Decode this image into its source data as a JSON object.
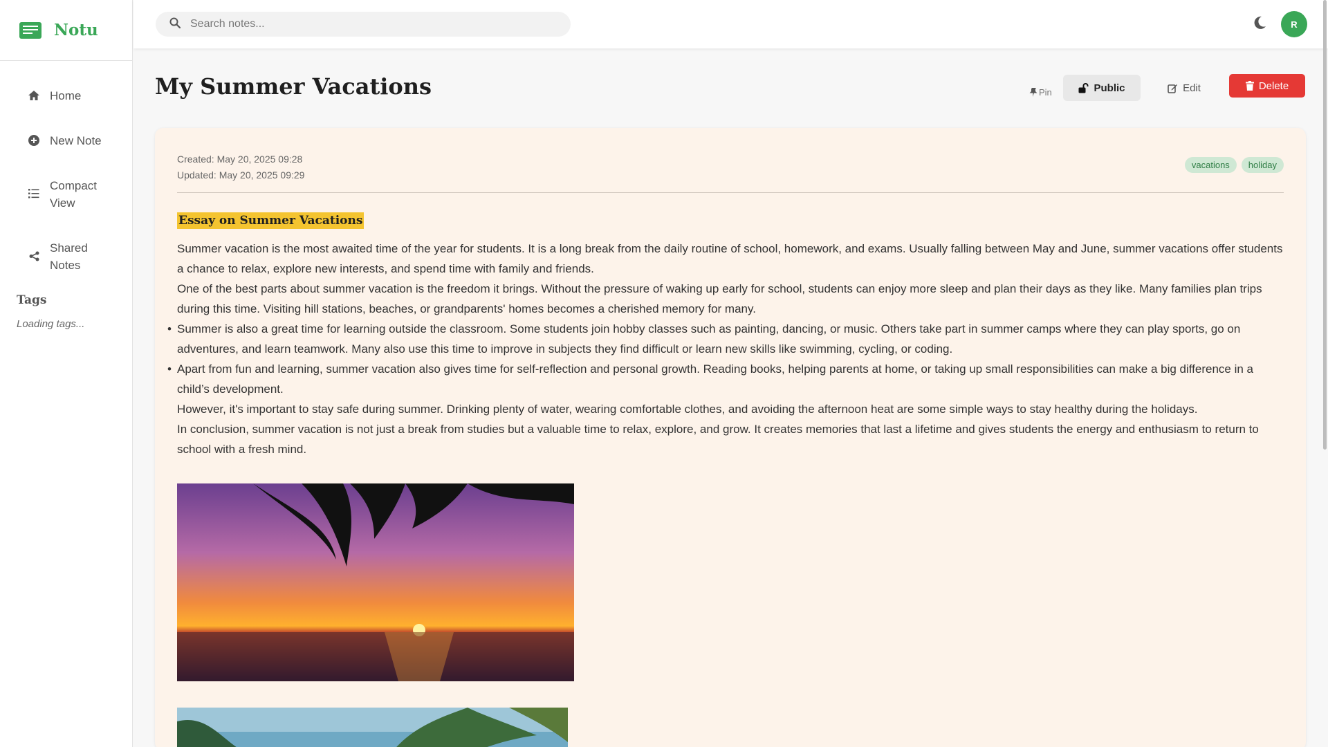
{
  "app": {
    "name": "Notu"
  },
  "sidebar": {
    "items": [
      {
        "label": "Home",
        "icon": "home-icon"
      },
      {
        "label": "New Note",
        "icon": "plus-circle-icon"
      },
      {
        "label": "Compact View",
        "icon": "list-icon"
      },
      {
        "label": "Shared Notes",
        "icon": "share-icon"
      }
    ],
    "tags_title": "Tags",
    "tags_loading": "Loading tags..."
  },
  "topbar": {
    "search_placeholder": "Search notes...",
    "avatar_initial": "R"
  },
  "note": {
    "title": "My Summer Vacations",
    "actions": {
      "pin": "Pin",
      "public": "Public",
      "edit": "Edit",
      "delete": "Delete"
    },
    "created": "Created: May 20, 2025 09:28",
    "updated": "Updated: May 20, 2025 09:29",
    "tags": [
      "vacations",
      "holiday"
    ],
    "heading": "Essay on Summer Vacations",
    "p1": "Summer vacation is the most awaited time of the year for students. It is a long break from the daily routine of school, homework, and exams. Usually falling between May and June, summer vacations offer students a chance to relax, explore new interests, and spend time with family and friends.",
    "p2": "One of the best parts about summer vacation is the freedom it brings. Without the pressure of waking up early for school, students can enjoy more sleep and plan their days as they like. Many families plan trips during this time. Visiting hill stations, beaches, or grandparents' homes becomes a cherished memory for many.",
    "b1": "Summer is also a great time for learning outside the classroom. Some students join hobby classes such as painting, dancing, or music. Others take part in summer camps where they can play sports, go on adventures, and learn teamwork. Many also use this time to improve in subjects they find difficult or learn new skills like swimming, cycling, or coding.",
    "b2": "Apart from fun and learning, summer vacation also gives time for self-reflection and personal growth. Reading books, helping parents at home, or taking up small responsibilities can make a big difference in a child’s development.",
    "p3": "However, it's important to stay safe during summer. Drinking plenty of water, wearing comfortable clothes, and avoiding the afternoon heat are some simple ways to stay healthy during the holidays.",
    "p4": "In conclusion, summer vacation is not just a break from studies but a valuable time to relax, explore, and grow. It creates memories that last a lifetime and gives students the energy and enthusiasm to return to school with a fresh mind."
  },
  "colors": {
    "brand": "#3aa757",
    "delete": "#e53935",
    "highlight": "#f4c430",
    "card": "#fdf3ea"
  }
}
